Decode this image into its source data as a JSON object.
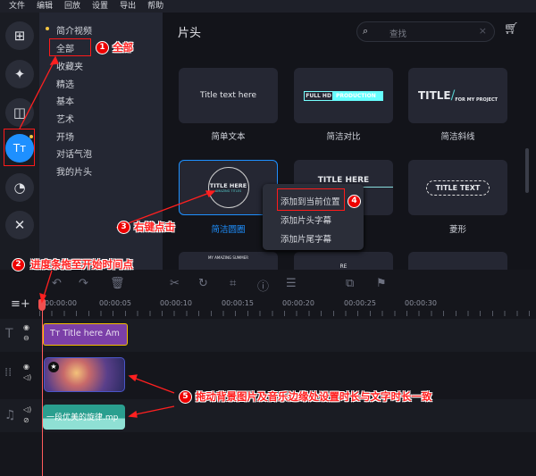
{
  "menu": [
    "文件",
    "编辑",
    "回放",
    "设置",
    "导出",
    "帮助"
  ],
  "rail": [
    {
      "icon": "import-folder-icon"
    },
    {
      "icon": "magic-wand-icon"
    },
    {
      "icon": "transition-icon"
    },
    {
      "icon": "titles-icon",
      "label": "Tт"
    },
    {
      "icon": "sticker-icon"
    },
    {
      "icon": "tools-icon"
    }
  ],
  "categories": {
    "header": "简介视频",
    "items": [
      "全部",
      "收藏夹",
      "精选",
      "基本",
      "艺术",
      "开场",
      "对话气泡",
      "我的片头"
    ]
  },
  "main": {
    "title": "片头",
    "search_placeholder": "查找",
    "thumbnails": [
      {
        "label": "简单文本",
        "preview": "Title text here"
      },
      {
        "label": "简洁对比",
        "preview_a": "FULL HD",
        "preview_b": "PRODUCTION"
      },
      {
        "label": "简洁斜线",
        "preview_a": "TITLE",
        "preview_b": "FOR MY PROJECT"
      },
      {
        "label": "简洁圆圈",
        "preview_a": "TITLE HERE",
        "preview_b": "AMAZING TITLES",
        "selected": true
      },
      {
        "label": "",
        "preview_a": "TITLE HERE",
        "preview_b": "E"
      },
      {
        "label": "菱形",
        "preview": "TITLE TEXT"
      },
      {
        "label": "",
        "preview": "MY AMAZING SUMMER"
      },
      {
        "label": "",
        "preview": "RE"
      },
      {
        "label": "",
        "preview": ""
      }
    ]
  },
  "context_menu": [
    "添加到当前位置",
    "添加片头字幕",
    "添加片尾字幕"
  ],
  "timeline": {
    "ruler": [
      "00:00:00",
      "00:00:05",
      "00:00:10",
      "00:00:15",
      "00:00:20",
      "00:00:25",
      "00:00:30"
    ],
    "text_clip": "Title here Am",
    "audio_clip": "一段优美的旋律.mp"
  },
  "annotations": [
    {
      "n": "1",
      "text": "全部"
    },
    {
      "n": "2",
      "text": "进度条拖至开始时间点"
    },
    {
      "n": "3",
      "text": "右键点击"
    },
    {
      "n": "4",
      "text": ""
    },
    {
      "n": "5",
      "text": "拖动背景图片及音乐边缘处设置时长与文字时长一致"
    }
  ],
  "colors": {
    "accent": "#1e90ff",
    "annotation": "#ff2020",
    "text_clip": "#7b3fa8",
    "audio_clip": "#2a9f8f"
  }
}
